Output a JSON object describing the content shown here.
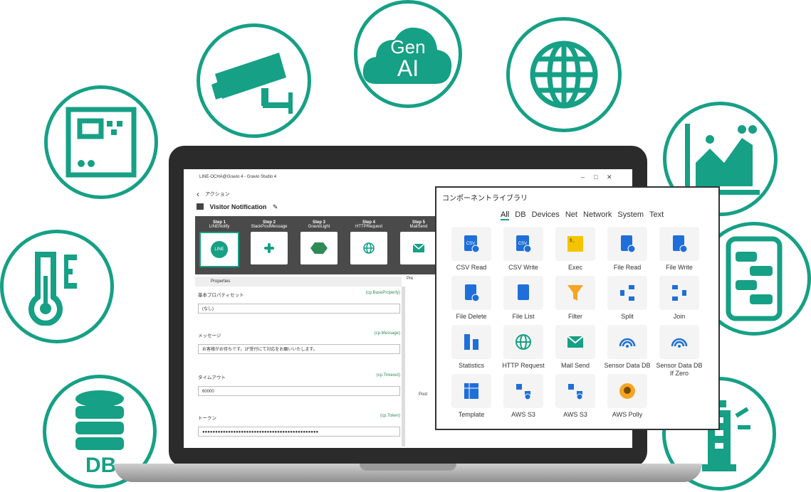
{
  "window": {
    "title": "LINE-OCHA@Gravio 4 - Gravio Studio 4",
    "minimize": "–",
    "maximize": "□",
    "close": "✕"
  },
  "nav": {
    "back": "‹",
    "label": "アクション"
  },
  "flow": {
    "name": "Visitor Notification"
  },
  "steps": [
    {
      "num": "Step 1",
      "name": "LINENotify",
      "badge": "LINE"
    },
    {
      "num": "Step 2",
      "name": "SlackPostMessage"
    },
    {
      "num": "Step 3",
      "name": "GravioLight"
    },
    {
      "num": "Step 4",
      "name": "HTTPRequest"
    },
    {
      "num": "Step 5",
      "name": "MailSend"
    }
  ],
  "properties": {
    "header": "Properties",
    "fields": [
      {
        "label": "基本プロパティセット",
        "cp": "(cp.BaseProperty)",
        "value": "(なし)"
      },
      {
        "label": "メッセージ",
        "cp": "(cp.Message)",
        "value": "お客様がお待ちです。1F受付にて対応をお願いいたします。"
      },
      {
        "label": "タイムアウト",
        "cp": "(cp.Timeout)",
        "value": "60000"
      },
      {
        "label": "トークン",
        "cp": "(cp.Token)",
        "value": "●●●●●●●●●●●●●●●●●●●●●●●●●●●●●●●●●●●●●●●●●●●●●"
      }
    ]
  },
  "preview": {
    "head": "Pre",
    "post": "Post"
  },
  "library": {
    "title": "コンポーネントライブラリ",
    "tabs": [
      "All",
      "DB",
      "Devices",
      "Net",
      "Network",
      "System",
      "Text"
    ],
    "active_tab": "All",
    "components": [
      {
        "name": "CSV Read",
        "icon": "csv-read-icon"
      },
      {
        "name": "CSV Write",
        "icon": "csv-write-icon"
      },
      {
        "name": "Exec",
        "icon": "terminal-icon"
      },
      {
        "name": "File Read",
        "icon": "file-read-icon"
      },
      {
        "name": "File Write",
        "icon": "file-write-icon"
      },
      {
        "name": "File Delete",
        "icon": "file-delete-icon"
      },
      {
        "name": "File List",
        "icon": "file-list-icon"
      },
      {
        "name": "Filter",
        "icon": "funnel-icon"
      },
      {
        "name": "Split",
        "icon": "split-icon"
      },
      {
        "name": "Join",
        "icon": "join-icon"
      },
      {
        "name": "Statistics",
        "icon": "statistics-icon"
      },
      {
        "name": "HTTP Request",
        "icon": "globe-icon"
      },
      {
        "name": "Mail Send",
        "icon": "mail-icon"
      },
      {
        "name": "Sensor Data DB",
        "icon": "sensor-icon"
      },
      {
        "name": "Sensor Data DB If Zero",
        "icon": "sensor-icon"
      },
      {
        "name": "Template",
        "icon": "template-icon"
      },
      {
        "name": "AWS S3",
        "icon": "s3-upload-icon"
      },
      {
        "name": "AWS S3",
        "icon": "s3-download-icon"
      },
      {
        "name": "AWS Polly",
        "icon": "polly-icon"
      }
    ]
  },
  "badges": {
    "genai_line1": "Gen",
    "genai_line2": "AI",
    "db": "DB"
  },
  "colors": {
    "accent": "#16a085",
    "blue": "#1e6fd9",
    "dark": "#4a4a4a"
  }
}
